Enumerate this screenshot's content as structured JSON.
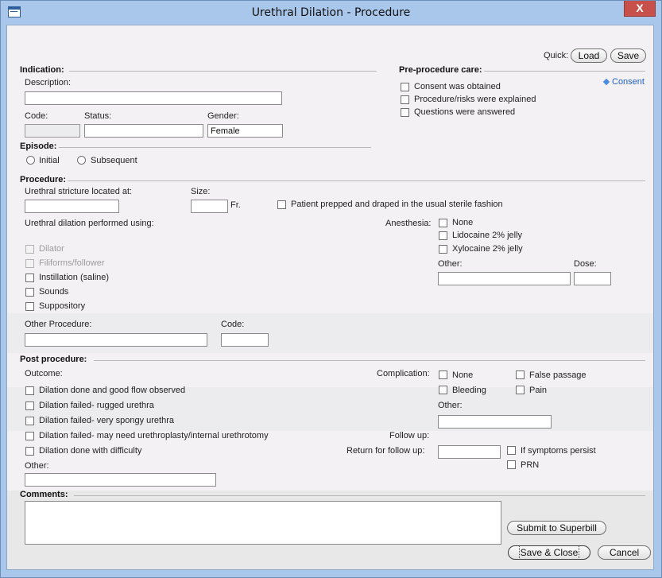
{
  "window": {
    "title": "Urethral Dilation - Procedure",
    "close_glyph": "X",
    "icon": "form-window-icon"
  },
  "quick": {
    "label": "Quick:",
    "load": "Load",
    "save": "Save"
  },
  "indication": {
    "header": "Indication:",
    "description_label": "Description:",
    "description_value": "",
    "code_label": "Code:",
    "status_label": "Status:",
    "gender_label": "Gender:",
    "gender_value": "Female"
  },
  "preprocedure": {
    "header": "Pre-procedure care:",
    "consent_link": "Consent",
    "items": [
      "Consent was obtained",
      "Procedure/risks were explained",
      "Questions were answered"
    ]
  },
  "episode": {
    "header": "Episode:",
    "options": [
      "Initial",
      "Subsequent"
    ]
  },
  "procedure": {
    "header": "Procedure:",
    "stricture_label": "Urethral stricture located at:",
    "size_label": "Size:",
    "size_unit": "Fr.",
    "prepped_label": "Patient prepped and draped in the usual sterile fashion",
    "performed_using_label": "Urethral dilation performed using:",
    "methods": [
      "Dilator",
      "Filiforms/follower",
      "Instillation (saline)",
      "Sounds",
      "Suppository"
    ],
    "anesthesia_label": "Anesthesia:",
    "anesthesia_options": [
      "None",
      "Lidocaine 2% jelly",
      "Xylocaine 2% jelly"
    ],
    "other_label": "Other:",
    "dose_label": "Dose:",
    "other_procedure_label": "Other Procedure:",
    "code_label": "Code:"
  },
  "post": {
    "header": "Post procedure:",
    "outcome_label": "Outcome:",
    "outcomes": [
      "Dilation done and good flow observed",
      "Dilation failed- rugged urethra",
      "Dilation failed- very spongy urethra",
      "Dilation failed- may need urethroplasty/internal urethrotomy",
      "Dilation done with difficulty"
    ],
    "other_label": "Other:",
    "complication_label": "Complication:",
    "complications": [
      "None",
      "False passage",
      "Bleeding",
      "Pain"
    ],
    "complication_other_label": "Other:",
    "followup_label": "Follow up:",
    "return_label": "Return for follow up:",
    "followup_options": [
      "If symptoms persist",
      "PRN"
    ]
  },
  "comments": {
    "header": "Comments:"
  },
  "buttons": {
    "submit": "Submit to Superbill",
    "save_close": "Save & Close",
    "cancel": "Cancel"
  }
}
